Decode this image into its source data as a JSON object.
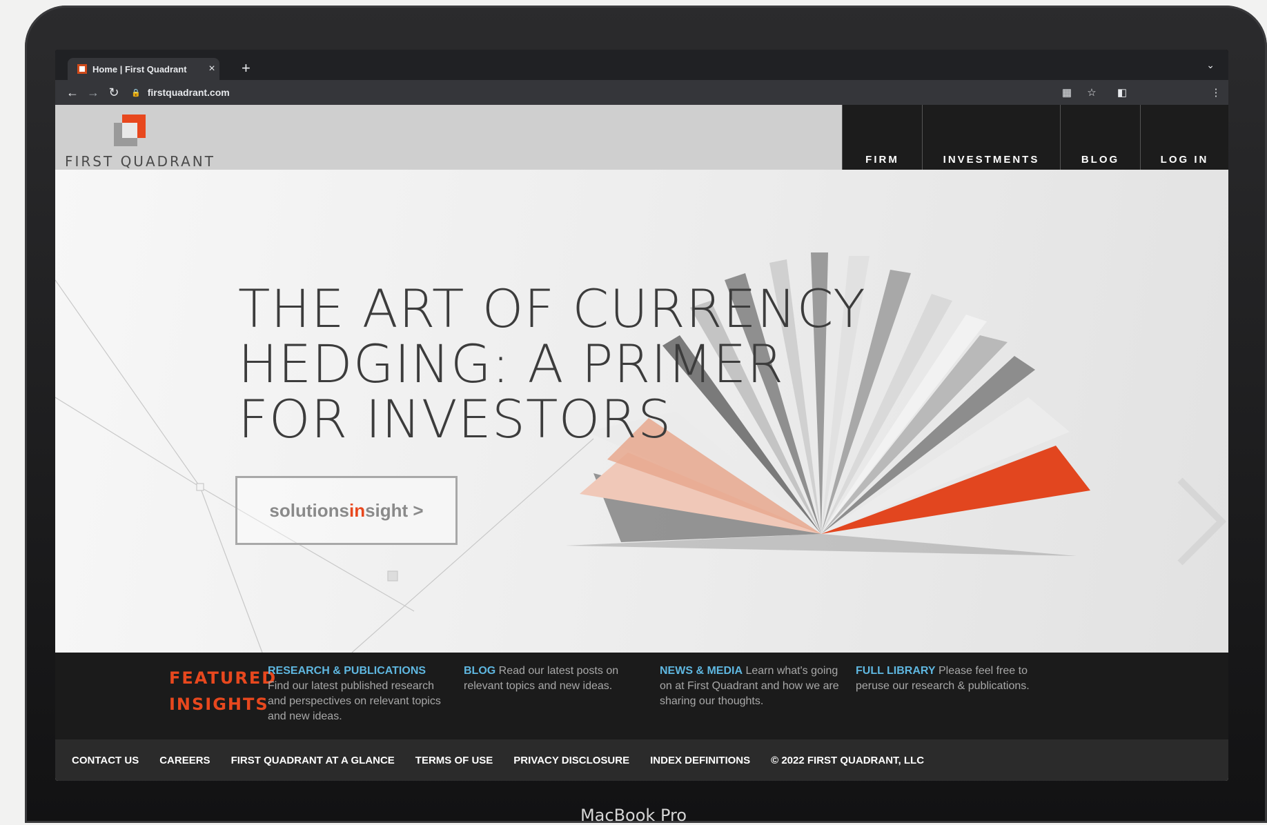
{
  "browser": {
    "tab_title": "Home | First Quadrant",
    "tab_close": "×",
    "new_tab": "+",
    "tab_menu": "⌄",
    "url": "firstquadrant.com",
    "icons": [
      "back-icon",
      "forward-icon",
      "reload-icon",
      "lock-icon",
      "qr-icon",
      "bookmark-star-icon",
      "side-panel-icon",
      "menu-kebab-icon"
    ]
  },
  "site": {
    "logo_text": "FIRST QUADRANT",
    "nav": [
      "FIRM",
      "INVESTMENTS",
      "BLOG",
      "LOG IN"
    ],
    "hero_title": "THE ART OF CURRENCY\nHEDGING: A PRIMER\nFOR INVESTORS",
    "cta": {
      "part1": "solutions",
      "part2": "in",
      "part3": "sight >"
    },
    "featured_heading": "FEATURED\nINSIGHTS",
    "featured": [
      {
        "link": "RESEARCH & PUBLICATIONS",
        "text": "Find our latest published research and perspectives on relevant topics and new ideas."
      },
      {
        "link": "BLOG",
        "text": "Read our latest posts on relevant topics and new ideas."
      },
      {
        "link": "NEWS & MEDIA",
        "text": "Learn what's going on at First Quadrant and how we are sharing our thoughts."
      },
      {
        "link": "FULL LIBRARY",
        "text": "Please feel free to peruse our research & publications."
      }
    ],
    "footer_links": [
      "CONTACT US",
      "CAREERS",
      "FIRST QUADRANT AT A GLANCE",
      "TERMS OF USE",
      "PRIVACY DISCLOSURE",
      "INDEX DEFINITIONS"
    ],
    "copyright": "© 2022 FIRST QUADRANT, LLC"
  },
  "device_label": "MacBook Pro",
  "colors": {
    "accent": "#e8481e",
    "link": "#5fb7e0",
    "nav_bg": "#1c1c1c"
  }
}
